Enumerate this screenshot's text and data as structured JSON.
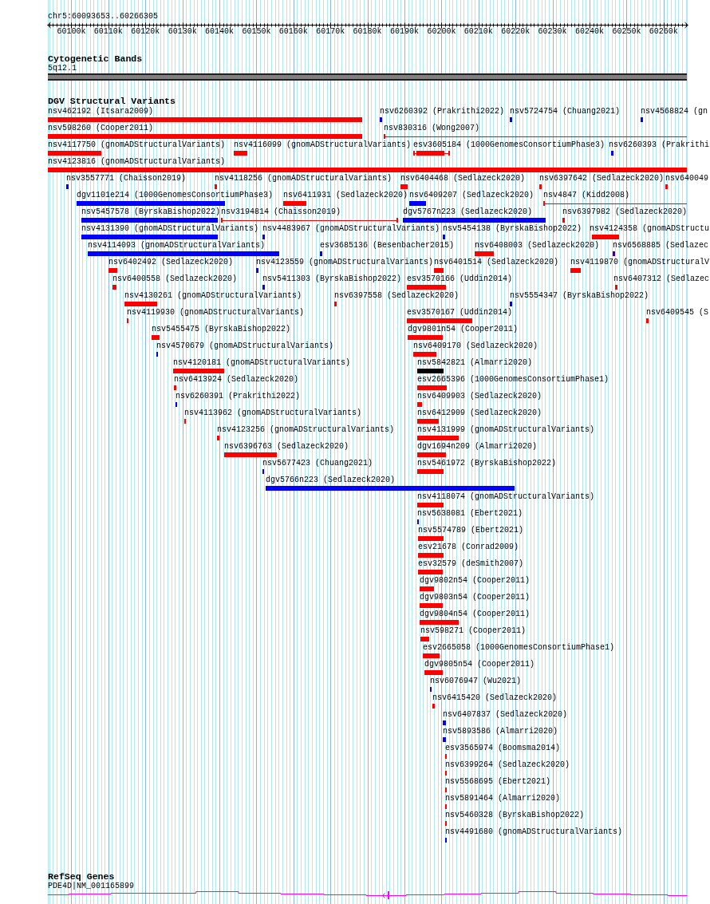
{
  "location": "chr5:60093653..60266305",
  "ruler": {
    "ticks": [
      "60100k",
      "60110k",
      "60120k",
      "60130k",
      "60140k",
      "60150k",
      "60160k",
      "60170k",
      "60180k",
      "60190k",
      "60200k",
      "60210k",
      "60220k",
      "60230k",
      "60240k",
      "60250k",
      "60260k"
    ]
  },
  "cytoband_track": {
    "title": "Cytogenetic Bands",
    "band": "5q12.1"
  },
  "variant_track": {
    "title": "DGV Structural Variants",
    "rows": [
      {
        "features": [
          {
            "label": "nsv462192 (Itsara2009)",
            "color": "#ff0000",
            "kind": "bar"
          },
          {
            "label": "nsv6260392 (Prakrithi2022)",
            "color": "#0000ff",
            "kind": "bar"
          },
          {
            "label": "nsv5724754 (Chuang2021)",
            "color": "#0000ff",
            "kind": "bar"
          },
          {
            "label": "nsv4568824 (gn",
            "color": "#0000ff",
            "kind": "bar"
          }
        ]
      },
      {
        "features": [
          {
            "label": "nsv598260 (Cooper2011)",
            "color": "#ff0000",
            "kind": "bar"
          },
          {
            "label": "nsv830316 (Wong2007)",
            "color": "#ff0000",
            "kind": "span"
          }
        ]
      },
      {
        "features": [
          {
            "label": "nsv4117750 (gnomADStructuralVariants)",
            "color": "#ff0000",
            "kind": "bar"
          },
          {
            "label": "nsv4116099 (gnomADStructuralVariants)",
            "color": "#ff0000",
            "kind": "bar"
          },
          {
            "label": "esv3605184 (1000GenomesConsortiumPhase3)",
            "color": "#ff0000",
            "kind": "whisker"
          },
          {
            "label": "nsv6260393 (Prakrithi",
            "color": "#0000ff",
            "kind": "bar"
          }
        ]
      },
      {
        "features": [
          {
            "label": "nsv4123816 (gnomADStructuralVariants)",
            "color": "#ff0000",
            "kind": "bar"
          }
        ]
      },
      {
        "features": [
          {
            "label": "nsv3557771 (Chaisson2019)",
            "color": "#0000ff",
            "kind": "bar"
          },
          {
            "label": "nsv4118256 (gnomADStructuralVariants)",
            "color": "#ff0000",
            "kind": "bar"
          },
          {
            "label": "nsv6404468 (Sedlazeck2020)",
            "color": "#ff0000",
            "kind": "bar"
          },
          {
            "label": "nsv6397642 (Sedlazeck2020)",
            "color": "#ff0000",
            "kind": "bar"
          },
          {
            "label": "nsv640049",
            "color": "#ff0000",
            "kind": "bar"
          }
        ]
      },
      {
        "features": [
          {
            "label": "dgv1101e214 (1000GenomesConsortiumPhase3)",
            "color": "#0000ff",
            "kind": "bar"
          },
          {
            "label": "nsv6411931 (Sedlazeck2020)",
            "color": "#ff0000",
            "kind": "bar"
          },
          {
            "label": "nsv6409207 (Sedlazeck2020)",
            "color": "#0000ff",
            "kind": "bar"
          },
          {
            "label": "nsv4847 (Kidd2008)",
            "color": "#ff0000",
            "kind": "span"
          }
        ]
      },
      {
        "features": [
          {
            "label": "nsv5457578 (ByrskaBishop2022)",
            "color": "#0000ff",
            "kind": "bar"
          },
          {
            "label": "nsv3194814 (Chaisson2019)",
            "color": "#ff0000",
            "kind": "span"
          },
          {
            "label": "dgv5767n223 (Sedlazeck2020)",
            "color": "#0000ff",
            "kind": "bar"
          },
          {
            "label": "nsv6397982 (Sedlazeck2020)",
            "color": "#ff0000",
            "kind": "bar"
          }
        ]
      },
      {
        "features": [
          {
            "label": "nsv4131390 (gnomADStructuralVariants)",
            "color": "#0000ff",
            "kind": "bar"
          },
          {
            "label": "nsv4483967 (gnomADStructuralVariants)",
            "color": "#0000ff",
            "kind": "bar"
          },
          {
            "label": "nsv5454138 (ByrskaBishop2022)",
            "color": "#0000ff",
            "kind": "bar"
          },
          {
            "label": "nsv4124358 (gnomADStructu",
            "color": "#ff0000",
            "kind": "bar"
          }
        ]
      },
      {
        "features": [
          {
            "label": "nsv4114093 (gnomADStructuralVariants)",
            "color": "#0000ff",
            "kind": "bar"
          },
          {
            "label": "esv3685136 (Besenbacher2015)",
            "color": "#0000ff",
            "kind": "bar"
          },
          {
            "label": "nsv6408003 (Sedlazeck2020)",
            "color": "#ff0000",
            "kind": "bar"
          },
          {
            "label": "nsv6568885 (Sedlazec",
            "color": "#400080",
            "kind": "bar"
          }
        ]
      },
      {
        "features": [
          {
            "label": "nsv6402492 (Sedlazeck2020)",
            "color": "#ff0000",
            "kind": "bar"
          },
          {
            "label": "nsv4123559 (gnomADStructuralVariants)",
            "color": "#0000ff",
            "kind": "bar"
          },
          {
            "label": "nsv6401514 (Sedlazeck2020)",
            "color": "#ff0000",
            "kind": "bar"
          },
          {
            "label": "nsv4119870 (gnomADStructuralV",
            "color": "#ff0000",
            "kind": "bar"
          }
        ]
      },
      {
        "features": [
          {
            "label": "nsv6400558 (Sedlazeck2020)",
            "color": "#ff0000",
            "kind": "bar"
          },
          {
            "label": "nsv5411303 (ByrskaBishop2022)",
            "color": "#0000ff",
            "kind": "bar"
          },
          {
            "label": "esv3570166 (Uddin2014)",
            "color": "#ff0000",
            "kind": "bar"
          },
          {
            "label": "nsv6407312 (Sedlazec",
            "color": "#ff0000",
            "kind": "bar"
          }
        ]
      },
      {
        "features": [
          {
            "label": "nsv4130261 (gnomADStructuralVariants)",
            "color": "#ff0000",
            "kind": "bar"
          },
          {
            "label": "nsv6397558 (Sedlazeck2020)",
            "color": "#ff0000",
            "kind": "bar"
          },
          {
            "label": "nsv5554347 (ByrskaBishop2022)",
            "color": "#0000ff",
            "kind": "bar"
          }
        ]
      },
      {
        "features": [
          {
            "label": "nsv4119930 (gnomADStructuralVariants)",
            "color": "#ff0000",
            "kind": "bar"
          },
          {
            "label": "esv3570167 (Uddin2014)",
            "color": "#ff0000",
            "kind": "bar"
          },
          {
            "label": "nsv6409545 (S",
            "color": "#ff0000",
            "kind": "bar"
          }
        ]
      },
      {
        "features": [
          {
            "label": "nsv5455475 (ByrskaBishop2022)",
            "color": "#ff0000",
            "kind": "bar"
          },
          {
            "label": "dgv9801n54 (Cooper2011)",
            "color": "#ff0000",
            "kind": "bar"
          }
        ]
      },
      {
        "features": [
          {
            "label": "nsv4570679 (gnomADStructuralVariants)",
            "color": "#0000ff",
            "kind": "bar"
          },
          {
            "label": "nsv6409170 (Sedlazeck2020)",
            "color": "#ff0000",
            "kind": "bar"
          }
        ]
      },
      {
        "features": [
          {
            "label": "nsv4120181 (gnomADStructuralVariants)",
            "color": "#ff0000",
            "kind": "bar"
          },
          {
            "label": "nsv5842821 (Almarri2020)",
            "color": "#000000",
            "kind": "bar"
          }
        ]
      },
      {
        "features": [
          {
            "label": "nsv6413924 (Sedlazeck2020)",
            "color": "#ff0000",
            "kind": "bar"
          },
          {
            "label": "esv2665396 (1000GenomesConsortiumPhase1)",
            "color": "#ff0000",
            "kind": "bar"
          }
        ]
      },
      {
        "features": [
          {
            "label": "nsv6260391 (Prakrithi2022)",
            "color": "#0000ff",
            "kind": "bar"
          },
          {
            "label": "nsv6409903 (Sedlazeck2020)",
            "color": "#ff0000",
            "kind": "bar"
          }
        ]
      },
      {
        "features": [
          {
            "label": "nsv4113962 (gnomADStructuralVariants)",
            "color": "#ff0000",
            "kind": "bar"
          },
          {
            "label": "nsv6412909 (Sedlazeck2020)",
            "color": "#ff0000",
            "kind": "bar"
          }
        ]
      },
      {
        "features": [
          {
            "label": "nsv4123256 (gnomADStructuralVariants)",
            "color": "#ff0000",
            "kind": "bar"
          },
          {
            "label": "nsv4131999 (gnomADStructuralVariants)",
            "color": "#ff0000",
            "kind": "bar"
          }
        ]
      },
      {
        "features": [
          {
            "label": "nsv6396763 (Sedlazeck2020)",
            "color": "#ff0000",
            "kind": "bar"
          },
          {
            "label": "dgv1694n209 (Almarri2020)",
            "color": "#ff0000",
            "kind": "bar"
          }
        ]
      },
      {
        "features": [
          {
            "label": "nsv5677423 (Chuang2021)",
            "color": "#0000ff",
            "kind": "bar"
          },
          {
            "label": "nsv5461972 (ByrskaBishop2022)",
            "color": "#ff0000",
            "kind": "bar"
          }
        ]
      },
      {
        "features": [
          {
            "label": "dgv5766n223 (Sedlazeck2020)",
            "color": "#0000ff",
            "kind": "bar"
          }
        ]
      },
      {
        "features": [
          {
            "label": "nsv4118074 (gnomADStructuralVariants)",
            "color": "#ff0000",
            "kind": "bar"
          }
        ]
      },
      {
        "features": [
          {
            "label": "nsv5638081 (Ebert2021)",
            "color": "#0000ff",
            "kind": "bar"
          }
        ]
      },
      {
        "features": [
          {
            "label": "nsv5574789 (Ebert2021)",
            "color": "#ff0000",
            "kind": "bar"
          }
        ]
      },
      {
        "features": [
          {
            "label": "esv21678 (Conrad2009)",
            "color": "#ff0000",
            "kind": "bar"
          }
        ]
      },
      {
        "features": [
          {
            "label": "esv32579 (deSmith2007)",
            "color": "#ff0000",
            "kind": "bar"
          }
        ]
      },
      {
        "features": [
          {
            "label": "dgv9802n54 (Cooper2011)",
            "color": "#ff0000",
            "kind": "bar"
          }
        ]
      },
      {
        "features": [
          {
            "label": "dgv9803n54 (Cooper2011)",
            "color": "#ff0000",
            "kind": "bar"
          }
        ]
      },
      {
        "features": [
          {
            "label": "dgv9804n54 (Cooper2011)",
            "color": "#ff0000",
            "kind": "bar"
          }
        ]
      },
      {
        "features": [
          {
            "label": "nsv598271 (Cooper2011)",
            "color": "#ff0000",
            "kind": "bar"
          }
        ]
      },
      {
        "features": [
          {
            "label": "esv2665058 (1000GenomesConsortiumPhase1)",
            "color": "#ff0000",
            "kind": "bar"
          }
        ]
      },
      {
        "features": [
          {
            "label": "dgv9805n54 (Cooper2011)",
            "color": "#ff0000",
            "kind": "bar"
          }
        ]
      },
      {
        "features": [
          {
            "label": "nsv6076947 (Wu2021)",
            "color": "#0000ff",
            "kind": "bar"
          }
        ]
      },
      {
        "features": [
          {
            "label": "nsv6415420 (Sedlazeck2020)",
            "color": "#ff0000",
            "kind": "bar"
          }
        ]
      },
      {
        "features": [
          {
            "label": "nsv6407837 (Sedlazeck2020)",
            "color": "#0000ff",
            "kind": "bar"
          }
        ]
      },
      {
        "features": [
          {
            "label": "nsv5893586 (Almarri2020)",
            "color": "#0000ff",
            "kind": "bar"
          }
        ]
      },
      {
        "features": [
          {
            "label": "esv3565974 (Boomsma2014)",
            "color": "#ff0000",
            "kind": "bar"
          }
        ]
      },
      {
        "features": [
          {
            "label": "nsv6399264 (Sedlazeck2020)",
            "color": "#ff0000",
            "kind": "bar"
          }
        ]
      },
      {
        "features": [
          {
            "label": "nsv5568695 (Ebert2021)",
            "color": "#ff0000",
            "kind": "bar"
          }
        ]
      },
      {
        "features": [
          {
            "label": "nsv5891464 (Almarri2020)",
            "color": "#ff0000",
            "kind": "bar"
          }
        ]
      },
      {
        "features": [
          {
            "label": "nsv5460328 (ByrskaBishop2022)",
            "color": "#ff0000",
            "kind": "bar"
          }
        ]
      },
      {
        "features": [
          {
            "label": "nsv4491680 (gnomADStructuralVariants)",
            "color": "#0000ff",
            "kind": "bar"
          }
        ]
      }
    ]
  },
  "gene_track": {
    "title": "RefSeq Genes",
    "gene": "PDE4D|NM_001165899"
  }
}
